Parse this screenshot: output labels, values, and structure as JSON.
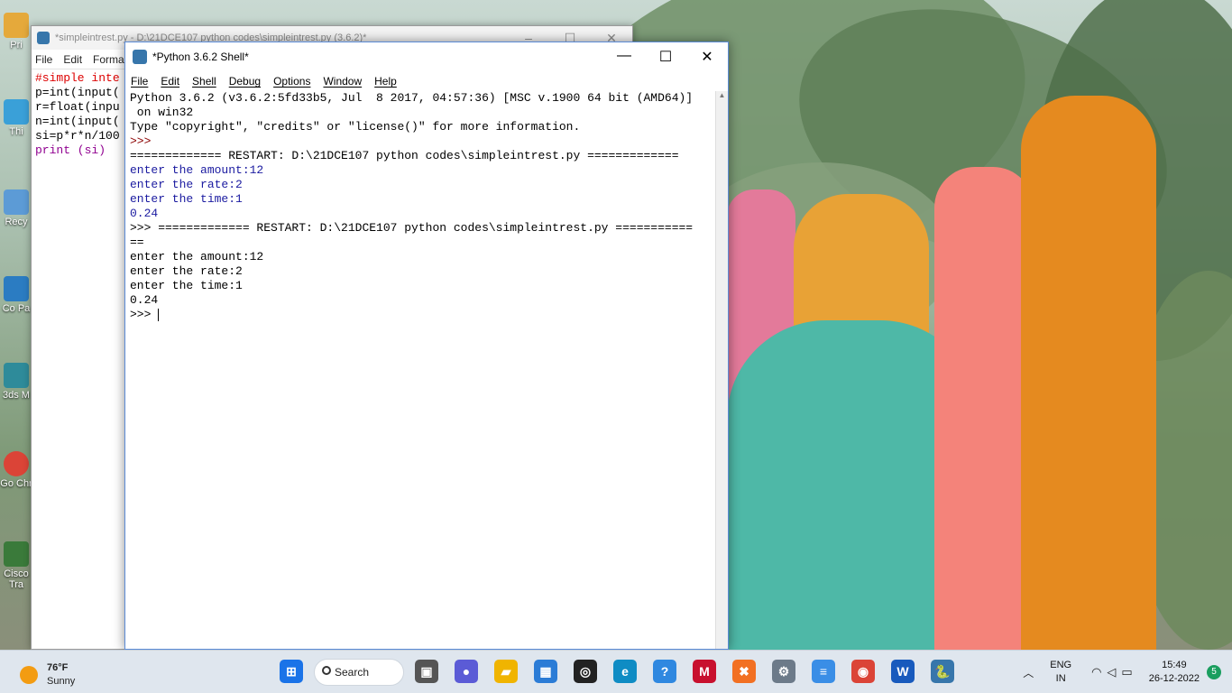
{
  "desktop": {
    "icons": [
      {
        "label": "Pri",
        "color": "#e5a93b"
      },
      {
        "label": "Thi",
        "color": "#3aa0d8"
      },
      {
        "label": "Recy",
        "color": "#5c9bd6"
      },
      {
        "label": "Co Pa",
        "color": "#2b7cc2"
      },
      {
        "label": "3ds M",
        "color": "#2e8b9a"
      },
      {
        "label": "Go Chr",
        "color": "#db4437"
      },
      {
        "label": "Cisco Tra",
        "color": "#3a7a3a"
      }
    ]
  },
  "editor": {
    "title": "*simpleintrest.py - D:\\21DCE107 python codes\\simpleintrest.py (3.6.2)*",
    "menu": [
      "File",
      "Edit",
      "Forma"
    ],
    "code_lines": [
      {
        "text": "#simple inte",
        "color": "#dd0000"
      },
      {
        "text": "p=int(input(",
        "color": "#000000"
      },
      {
        "text": "r=float(inpu",
        "color": "#000000"
      },
      {
        "text": "n=int(input(",
        "color": "#000000"
      },
      {
        "text": "si=p*r*n/100",
        "color": "#000000"
      },
      {
        "text": "print (si)",
        "color": "#900090"
      }
    ],
    "controls": [
      "–",
      "☐",
      "✕"
    ]
  },
  "shell": {
    "title": "*Python 3.6.2 Shell*",
    "menu": [
      "File",
      "Edit",
      "Shell",
      "Debug",
      "Options",
      "Window",
      "Help"
    ],
    "controls": [
      "—",
      "☐",
      "✕"
    ],
    "lines": [
      {
        "text": "Python 3.6.2 (v3.6.2:5fd33b5, Jul  8 2017, 04:57:36) [MSC v.1900 64 bit (AMD64)]",
        "color": "#000000"
      },
      {
        "text": " on win32",
        "color": "#000000"
      },
      {
        "text": "Type \"copyright\", \"credits\" or \"license()\" for more information.",
        "color": "#000000"
      },
      {
        "text": ">>> ",
        "color": "#8b0000"
      },
      {
        "text": "============= RESTART: D:\\21DCE107 python codes\\simpleintrest.py =============",
        "color": "#000000"
      },
      {
        "text": "enter the amount:12",
        "color": "#1a1aa0"
      },
      {
        "text": "enter the rate:2",
        "color": "#1a1aa0"
      },
      {
        "text": "enter the time:1",
        "color": "#1a1aa0"
      },
      {
        "text": "0.24",
        "color": "#1a1aa0"
      },
      {
        "text": ">>> ============= RESTART: D:\\21DCE107 python codes\\simpleintrest.py ===========",
        "color": "#000000"
      },
      {
        "text": "==",
        "color": "#000000"
      },
      {
        "text": "enter the amount:12",
        "color": "#000000"
      },
      {
        "text": "enter the rate:2",
        "color": "#000000"
      },
      {
        "text": "enter the time:1",
        "color": "#000000"
      },
      {
        "text": "0.24",
        "color": "#000000"
      },
      {
        "text": ">>> ",
        "color": "#000000"
      }
    ]
  },
  "taskbar": {
    "weather_temp": "76°F",
    "weather_desc": "Sunny",
    "search_label": "Search",
    "apps": [
      {
        "name": "start-button",
        "glyph": "⊞",
        "color": "#1a73e8"
      },
      {
        "name": "task-view",
        "glyph": "▣",
        "color": "#555555"
      },
      {
        "name": "zoom-app",
        "glyph": "●",
        "color": "#5b5bd6"
      },
      {
        "name": "file-explorer",
        "glyph": "▰",
        "color": "#f0b400"
      },
      {
        "name": "store-app",
        "glyph": "▦",
        "color": "#2b7cd6"
      },
      {
        "name": "github-desktop",
        "glyph": "◎",
        "color": "#222222"
      },
      {
        "name": "edge-browser",
        "glyph": "e",
        "color": "#0f8cc4"
      },
      {
        "name": "help-app",
        "glyph": "?",
        "color": "#2f88e0"
      },
      {
        "name": "mcafee-app",
        "glyph": "M",
        "color": "#c8102e"
      },
      {
        "name": "xampp-app",
        "glyph": "✖",
        "color": "#f27022"
      },
      {
        "name": "settings-app",
        "glyph": "⚙",
        "color": "#6c7a89"
      },
      {
        "name": "notepad-app",
        "glyph": "≡",
        "color": "#3a8ee6"
      },
      {
        "name": "chrome-browser",
        "glyph": "◉",
        "color": "#db4437"
      },
      {
        "name": "word-app",
        "glyph": "W",
        "color": "#185abd"
      },
      {
        "name": "python-idle",
        "glyph": "🐍",
        "color": "#3776ab"
      }
    ],
    "lang_top": "ENG",
    "lang_bottom": "IN",
    "time": "15:49",
    "date": "26-12-2022",
    "notifications": "5"
  }
}
